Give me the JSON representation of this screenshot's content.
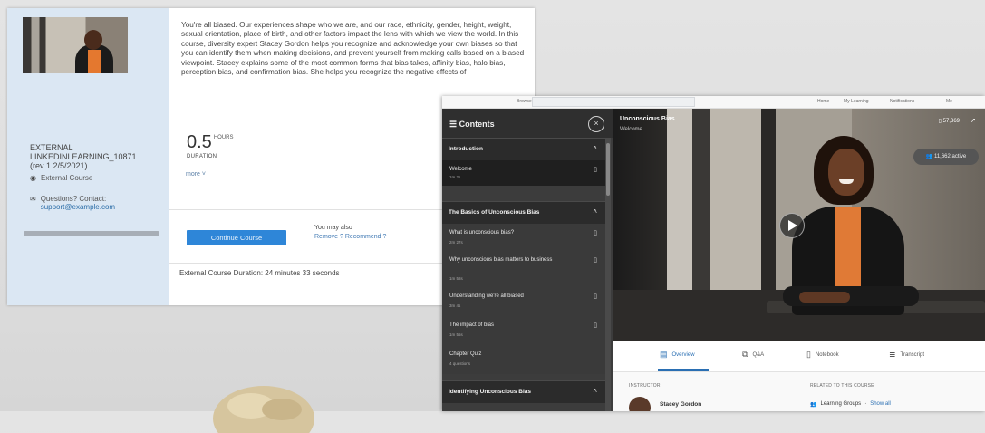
{
  "course_window": {
    "course_code": "EXTERNAL LINKEDINLEARNING_10871",
    "course_rev": "(rev 1 2/5/2021)",
    "type_label": "External Course",
    "questions_label": "Questions? Contact:",
    "contact_email": "support@example.com",
    "description": "You're all biased. Our experiences shape who we are, and our race, ethnicity, gender, height, weight, sexual orientation, place of birth, and other factors impact the lens with which we view the world. In this course, diversity expert Stacey Gordon helps you recognize and acknowledge your own biases so that you can identify them when making decisions, and prevent yourself from making calls based on a biased viewpoint. Stacey explains some of the most common forms that bias takes, affinity bias, halo bias, perception bias, and confirmation bias. She helps you recognize the negative effects of",
    "duration_value": "0.5",
    "duration_unit": "HOURS",
    "duration_label": "DURATION",
    "more_label": "more",
    "continue_button": "Continue Course",
    "also_label": "You may also",
    "also_links": "Remove ? Recommend ?",
    "external_duration": "External Course Duration: 24 minutes 33 seconds"
  },
  "linkedin_window": {
    "top_nav": {
      "brand": "Browse",
      "items": [
        "Home",
        "My Learning",
        "Notifications",
        "Me"
      ]
    },
    "sidebar": {
      "title": "Contents",
      "close_glyph": "×",
      "sections": [
        {
          "title": "Introduction",
          "items": [
            {
              "title": "Welcome",
              "duration": "1m 2s",
              "active": true
            }
          ]
        },
        {
          "title": "The Basics of Unconscious Bias",
          "items": [
            {
              "title": "What is unconscious bias?",
              "duration": "2m 27s"
            },
            {
              "title": "Why unconscious bias matters to business",
              "duration": "1m 58s"
            },
            {
              "title": "Understanding we're all biased",
              "duration": "3m 4s"
            },
            {
              "title": "The impact of bias",
              "duration": "1m 55s"
            },
            {
              "title": "Chapter Quiz",
              "duration": "4 questions"
            }
          ]
        },
        {
          "title": "Identifying Unconscious Bias",
          "items": []
        }
      ]
    },
    "video": {
      "title": "Unconscious Bias",
      "subtitle": "Welcome",
      "count": "57,369",
      "active_learners": "11,662 active"
    },
    "tabs": [
      {
        "label": "Overview",
        "icon": "overview-icon",
        "glyph": "▤"
      },
      {
        "label": "Q&A",
        "icon": "qa-icon",
        "glyph": "⧉"
      },
      {
        "label": "Notebook",
        "icon": "notebook-icon",
        "glyph": "▯"
      },
      {
        "label": "Transcript",
        "icon": "transcript-icon",
        "glyph": "≣"
      }
    ],
    "instructor_label": "INSTRUCTOR",
    "instructor_name": "Stacey Gordon",
    "related_label": "RELATED TO THIS COURSE",
    "learning_groups": "Learning Groups",
    "show_all": "Show all"
  },
  "colors": {
    "accent": "#2e86d8",
    "side_panel": "#dbe7f3",
    "video_sidebar": "#3c3c3c"
  }
}
